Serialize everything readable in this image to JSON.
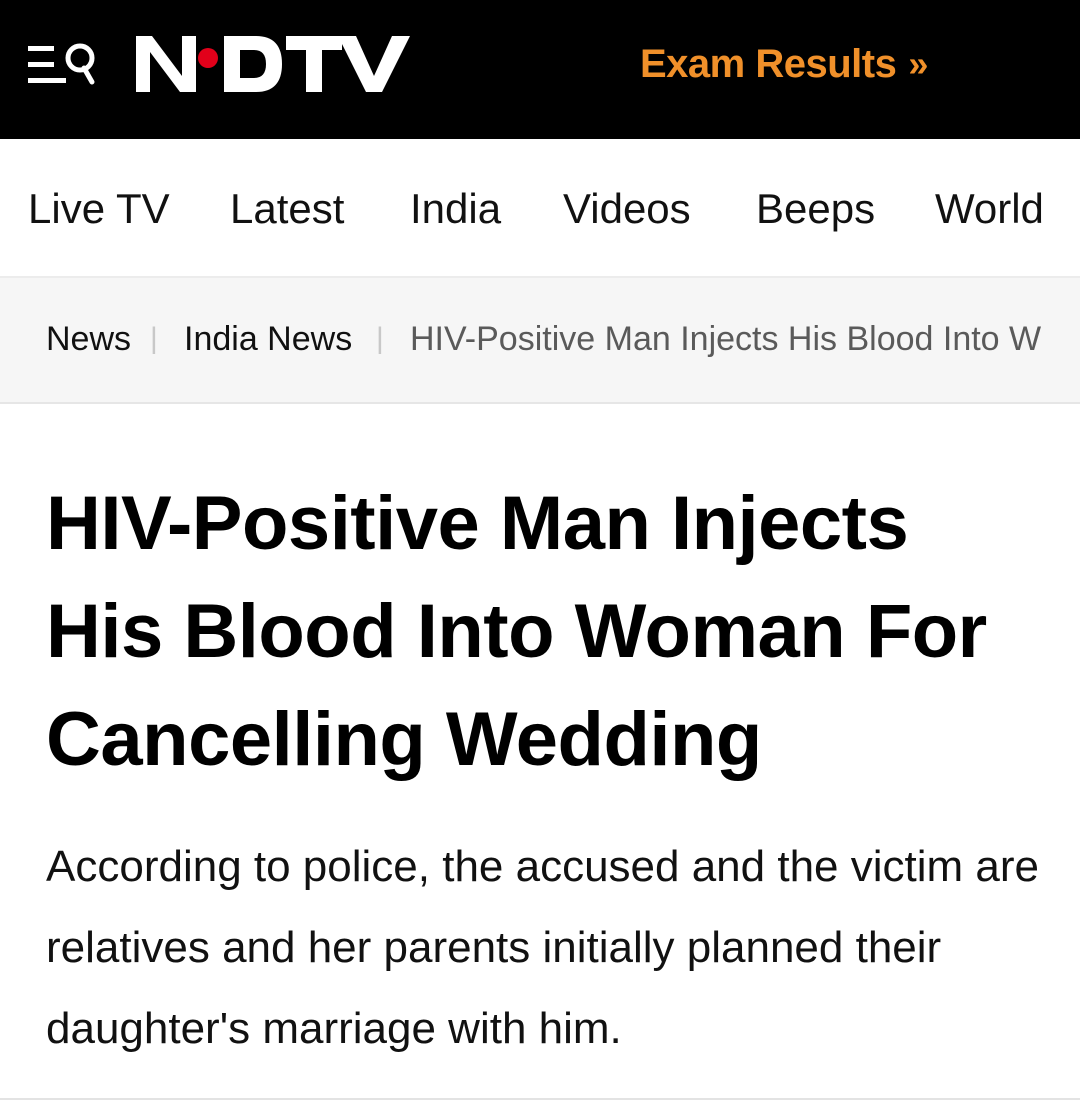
{
  "header": {
    "logo_text": "NDTV",
    "exam_link": "Exam Results",
    "exam_link_chevron": "»",
    "icons": [
      "menu-icon",
      "search-icon",
      "chevron-right-icon"
    ],
    "colors": {
      "bar": "#000000",
      "accent": "#f0902a",
      "logo_dot": "#e2001a"
    }
  },
  "nav": {
    "items": [
      {
        "label": "Live TV"
      },
      {
        "label": "Latest"
      },
      {
        "label": "India"
      },
      {
        "label": "Videos"
      },
      {
        "label": "Beeps"
      },
      {
        "label": "World"
      }
    ]
  },
  "breadcrumb": {
    "items": [
      {
        "label": "News"
      },
      {
        "label": "India News"
      },
      {
        "label": "HIV-Positive Man Injects His Blood Into W"
      }
    ],
    "separator": "|"
  },
  "article": {
    "headline": "HIV-Positive Man Injects His Blood Into Woman For Cancelling Wedding",
    "summary": "According to police, the accused and the victim are relatives and her parents initially planned their daughter's marriage with him."
  }
}
